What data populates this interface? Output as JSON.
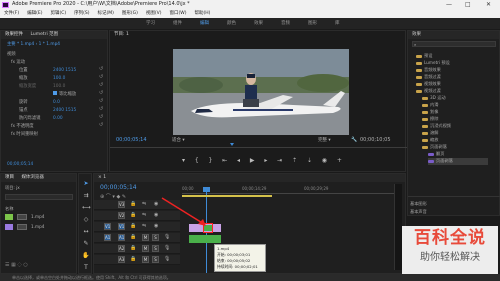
{
  "window": {
    "title": "Adobe Premiere Pro 2020 - C:\\用户\\W\\文档\\Adobe\\Premiere Pro\\14.0\\jx *",
    "minimize": "—",
    "maximize": "□",
    "close": "✕"
  },
  "menu": [
    "文件(F)",
    "编辑(E)",
    "剪辑(C)",
    "序列(S)",
    "标记(M)",
    "图形(G)",
    "视图(V)",
    "窗口(W)",
    "帮助(H)"
  ],
  "workspaces": [
    "学习",
    "组件",
    "编辑",
    "颜色",
    "效果",
    "音频",
    "图形",
    "库"
  ],
  "effect_controls": {
    "tabs": [
      "效果控件",
      "Lumetri 范围"
    ],
    "breadcrumb": "主要 * 1.mp4  ›  1 * 1.mp4",
    "rows": [
      {
        "label": "视频",
        "value": ""
      },
      {
        "label": "fx 运动",
        "value": ""
      },
      {
        "label": "位置",
        "value": "2400   1515"
      },
      {
        "label": "缩放",
        "value": "100.0"
      },
      {
        "label": "缩放宽度",
        "value": "100.0"
      },
      {
        "label": "",
        "value": "等比缩放"
      },
      {
        "label": "旋转",
        "value": "0.0"
      },
      {
        "label": "锚点",
        "value": "2400   1515"
      },
      {
        "label": "防闪烁滤镜",
        "value": "0.00"
      },
      {
        "label": "fx 不透明度",
        "value": ""
      },
      {
        "label": "fx 时间重映射",
        "value": ""
      }
    ],
    "timecode": "00;00;05;14"
  },
  "program_monitor": {
    "tab": "节目: 1",
    "timecode_left": "00;00;05;14",
    "fit": "适合",
    "quality": "完整",
    "timecode_right": "00;00;10;05"
  },
  "project": {
    "tab": "项目: jx",
    "tabs": [
      "项目",
      "媒体浏览器"
    ],
    "search_placeholder": "名称",
    "items": [
      {
        "name": "1.mp4"
      },
      {
        "name": "1.mp4"
      }
    ]
  },
  "timeline": {
    "tab": "1",
    "timecode": "00;00;05;14",
    "ruler": [
      "00;00",
      "00;00;14;29",
      "00;00;29;29"
    ],
    "tracks": [
      {
        "id": "V3"
      },
      {
        "id": "V2"
      },
      {
        "id": "V1"
      },
      {
        "id": "A1"
      },
      {
        "id": "A2"
      },
      {
        "id": "A3"
      }
    ],
    "tooltip": {
      "name": "1.mp4",
      "start": "开始: 00;00;03;01",
      "end": "结束: 00;00;05;02",
      "duration": "持续时间: 00;00;02;01"
    }
  },
  "effects": {
    "tab": "效果",
    "items": [
      "预设",
      "Lumetri 预设",
      "音频效果",
      "音频过渡",
      "视频效果",
      "视频过渡",
      "3D 运动",
      "内滑",
      "划像",
      "擦除",
      "沉浸式视频",
      "溶解",
      "缩放",
      "页面剥落"
    ],
    "selected": "交叉溶解",
    "sub_items": [
      "翻页",
      "页面剥落"
    ],
    "below_tabs": [
      "基本图形",
      "基本声音"
    ]
  },
  "status_bar": "单击以选择，或单击空白处并拖动以进行框选。使用 Shift、Alt 和 Ctrl 可获得其他选项。",
  "watermark": {
    "title": "百科全说",
    "subtitle": "助你轻松解决"
  }
}
